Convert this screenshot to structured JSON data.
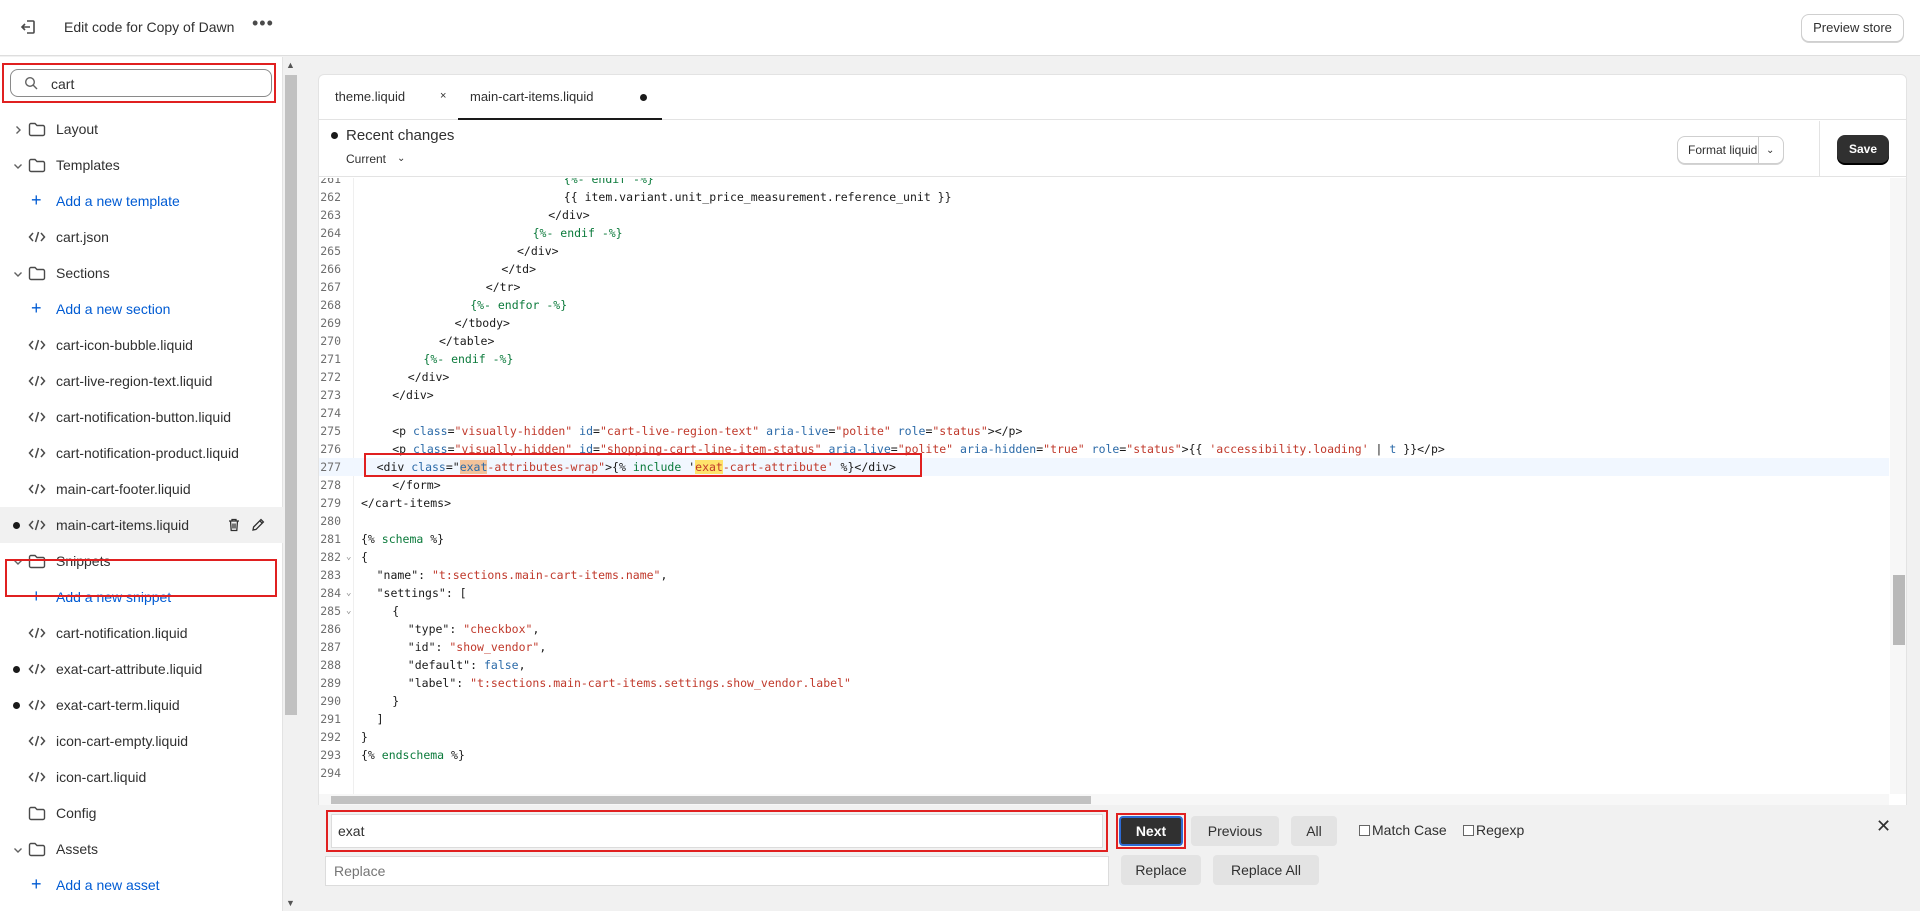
{
  "topbar": {
    "title": "Edit code for Copy of Dawn",
    "more_label": "•••",
    "preview_label": "Preview store"
  },
  "sidebar": {
    "search_value": "cart",
    "items": [
      {
        "kind": "folder",
        "label": "Layout",
        "expanded": false
      },
      {
        "kind": "folder",
        "label": "Templates",
        "expanded": true
      },
      {
        "kind": "add",
        "label": "Add a new template"
      },
      {
        "kind": "file",
        "label": "cart.json"
      },
      {
        "kind": "folder",
        "label": "Sections",
        "expanded": true
      },
      {
        "kind": "add",
        "label": "Add a new section"
      },
      {
        "kind": "file",
        "label": "cart-icon-bubble.liquid"
      },
      {
        "kind": "file",
        "label": "cart-live-region-text.liquid"
      },
      {
        "kind": "file",
        "label": "cart-notification-button.liquid"
      },
      {
        "kind": "file",
        "label": "cart-notification-product.liquid"
      },
      {
        "kind": "file",
        "label": "main-cart-footer.liquid"
      },
      {
        "kind": "file",
        "label": "main-cart-items.liquid",
        "active": true,
        "modified": true
      },
      {
        "kind": "folder",
        "label": "Snippets",
        "expanded": true
      },
      {
        "kind": "add",
        "label": "Add a new snippet"
      },
      {
        "kind": "file",
        "label": "cart-notification.liquid"
      },
      {
        "kind": "file",
        "label": "exat-cart-attribute.liquid",
        "modified": true
      },
      {
        "kind": "file",
        "label": "exat-cart-term.liquid",
        "modified": true
      },
      {
        "kind": "file",
        "label": "icon-cart-empty.liquid"
      },
      {
        "kind": "file",
        "label": "icon-cart.liquid"
      },
      {
        "kind": "folder",
        "label": "Config",
        "expanded": null
      },
      {
        "kind": "folder",
        "label": "Assets",
        "expanded": true
      },
      {
        "kind": "add",
        "label": "Add a new asset"
      }
    ]
  },
  "editor": {
    "tabs": [
      {
        "label": "theme.liquid",
        "close": "×"
      },
      {
        "label": "main-cart-items.liquid",
        "modified": true
      }
    ],
    "recent_changes_label": "Recent changes",
    "current_label": "Current",
    "format_label": "Format liquid",
    "save_label": "Save",
    "lines": [
      {
        "n": "261",
        "indent": 26,
        "t": [
          [
            "kw",
            "{%- endif -%}"
          ]
        ]
      },
      {
        "n": "262",
        "indent": 26,
        "t": [
          [
            "p",
            "{{ item.variant.unit_price_measurement.reference_unit }}"
          ]
        ]
      },
      {
        "n": "263",
        "indent": 24,
        "t": [
          [
            "p",
            "</div>"
          ]
        ]
      },
      {
        "n": "264",
        "indent": 22,
        "t": [
          [
            "kw",
            "{%- endif -%}"
          ]
        ]
      },
      {
        "n": "265",
        "indent": 20,
        "t": [
          [
            "p",
            "</div>"
          ]
        ]
      },
      {
        "n": "266",
        "indent": 18,
        "t": [
          [
            "p",
            "</td>"
          ]
        ]
      },
      {
        "n": "267",
        "indent": 16,
        "t": [
          [
            "p",
            "</tr>"
          ]
        ]
      },
      {
        "n": "268",
        "indent": 14,
        "t": [
          [
            "kw",
            "{%- endfor -%}"
          ]
        ]
      },
      {
        "n": "269",
        "indent": 12,
        "t": [
          [
            "p",
            "</tbody>"
          ]
        ]
      },
      {
        "n": "270",
        "indent": 10,
        "t": [
          [
            "p",
            "</table>"
          ]
        ]
      },
      {
        "n": "271",
        "indent": 8,
        "t": [
          [
            "kw",
            "{%- endif -%}"
          ]
        ]
      },
      {
        "n": "272",
        "indent": 6,
        "t": [
          [
            "p",
            "</div>"
          ]
        ]
      },
      {
        "n": "273",
        "indent": 4,
        "t": [
          [
            "p",
            "</div>"
          ]
        ]
      },
      {
        "n": "274",
        "indent": 0,
        "t": []
      },
      {
        "n": "275",
        "indent": 4,
        "t": [
          [
            "p",
            "<p "
          ],
          [
            "attr",
            "class"
          ],
          [
            "p",
            "="
          ],
          [
            "str",
            "\"visually-hidden\""
          ],
          [
            "p",
            " "
          ],
          [
            "attr",
            "id"
          ],
          [
            "p",
            "="
          ],
          [
            "str",
            "\"cart-live-region-text\""
          ],
          [
            "p",
            " "
          ],
          [
            "attr",
            "aria-live"
          ],
          [
            "p",
            "="
          ],
          [
            "str",
            "\"polite\""
          ],
          [
            "p",
            " "
          ],
          [
            "attr",
            "role"
          ],
          [
            "p",
            "="
          ],
          [
            "str",
            "\"status\""
          ],
          [
            "p",
            "></p>"
          ]
        ]
      },
      {
        "n": "276",
        "indent": 4,
        "t": [
          [
            "p",
            "<p "
          ],
          [
            "attr",
            "class"
          ],
          [
            "p",
            "="
          ],
          [
            "str",
            "\"visually-hidden\""
          ],
          [
            "p",
            " "
          ],
          [
            "attr",
            "id"
          ],
          [
            "p",
            "="
          ],
          [
            "str",
            "\"shopping-cart-line-item-status\""
          ],
          [
            "p",
            " "
          ],
          [
            "attr",
            "aria-live"
          ],
          [
            "p",
            "="
          ],
          [
            "str",
            "\"polite\""
          ],
          [
            "p",
            " "
          ],
          [
            "attr",
            "aria-hidden"
          ],
          [
            "p",
            "="
          ],
          [
            "str",
            "\"true\""
          ],
          [
            "p",
            " "
          ],
          [
            "attr",
            "role"
          ],
          [
            "p",
            "="
          ],
          [
            "str",
            "\"status\""
          ],
          [
            "p",
            ">{{ "
          ],
          [
            "str",
            "'accessibility.loading'"
          ],
          [
            "p",
            " | "
          ],
          [
            "attr",
            "t"
          ],
          [
            "p",
            " }}</p>"
          ]
        ]
      },
      {
        "n": "277",
        "indent": 2,
        "hl": true,
        "t": [
          [
            "p",
            "<div "
          ],
          [
            "attr",
            "class"
          ],
          [
            "p",
            "=\""
          ],
          [
            "m1",
            "exat"
          ],
          [
            "str",
            "-attributes-wrap\""
          ],
          [
            "p",
            ">{% "
          ],
          [
            "kw",
            "include"
          ],
          [
            "p",
            " '"
          ],
          [
            "m2",
            "exat"
          ],
          [
            "str",
            "-cart-attribute'"
          ],
          [
            "p",
            " %}</div>"
          ]
        ]
      },
      {
        "n": "278",
        "indent": 4,
        "t": [
          [
            "p",
            "</form>"
          ]
        ]
      },
      {
        "n": "279",
        "indent": 0,
        "t": [
          [
            "p",
            "</cart-items>"
          ]
        ]
      },
      {
        "n": "280",
        "indent": 0,
        "t": []
      },
      {
        "n": "281",
        "indent": 0,
        "t": [
          [
            "p",
            "{% "
          ],
          [
            "kw",
            "schema"
          ],
          [
            "p",
            " %}"
          ]
        ]
      },
      {
        "n": "282",
        "indent": 0,
        "fold": true,
        "t": [
          [
            "p",
            "{"
          ]
        ]
      },
      {
        "n": "283",
        "indent": 2,
        "t": [
          [
            "p",
            "\"name\": "
          ],
          [
            "str",
            "\"t:sections.main-cart-items.name\""
          ],
          [
            "p",
            ","
          ]
        ]
      },
      {
        "n": "284",
        "indent": 2,
        "fold": true,
        "t": [
          [
            "p",
            "\"settings\": ["
          ]
        ]
      },
      {
        "n": "285",
        "indent": 4,
        "fold": true,
        "t": [
          [
            "p",
            "{"
          ]
        ]
      },
      {
        "n": "286",
        "indent": 6,
        "t": [
          [
            "p",
            "\"type\": "
          ],
          [
            "str",
            "\"checkbox\""
          ],
          [
            "p",
            ","
          ]
        ]
      },
      {
        "n": "287",
        "indent": 6,
        "t": [
          [
            "p",
            "\"id\": "
          ],
          [
            "str",
            "\"show_vendor\""
          ],
          [
            "p",
            ","
          ]
        ]
      },
      {
        "n": "288",
        "indent": 6,
        "t": [
          [
            "p",
            "\"default\": "
          ],
          [
            "attr",
            "false"
          ],
          [
            "p",
            ","
          ]
        ]
      },
      {
        "n": "289",
        "indent": 6,
        "t": [
          [
            "p",
            "\"label\": "
          ],
          [
            "str",
            "\"t:sections.main-cart-items.settings.show_vendor.label\""
          ]
        ]
      },
      {
        "n": "290",
        "indent": 4,
        "t": [
          [
            "p",
            "}"
          ]
        ]
      },
      {
        "n": "291",
        "indent": 2,
        "t": [
          [
            "p",
            "]"
          ]
        ]
      },
      {
        "n": "292",
        "indent": 0,
        "t": [
          [
            "p",
            "}"
          ]
        ]
      },
      {
        "n": "293",
        "indent": 0,
        "t": [
          [
            "p",
            "{% "
          ],
          [
            "kw",
            "endschema"
          ],
          [
            "p",
            " %}"
          ]
        ]
      },
      {
        "n": "294",
        "indent": 0,
        "t": []
      }
    ]
  },
  "find": {
    "find_value": "exat",
    "replace_placeholder": "Replace",
    "next_label": "Next",
    "previous_label": "Previous",
    "all_label": "All",
    "match_case_label": "Match Case",
    "regexp_label": "Regexp",
    "replace_label": "Replace",
    "replace_all_label": "Replace All",
    "close_label": "✕"
  },
  "colors": {
    "accent": "#005bd3",
    "highlight": "#e02020",
    "keyword": "#0b7a3b",
    "string": "#c0392b"
  }
}
